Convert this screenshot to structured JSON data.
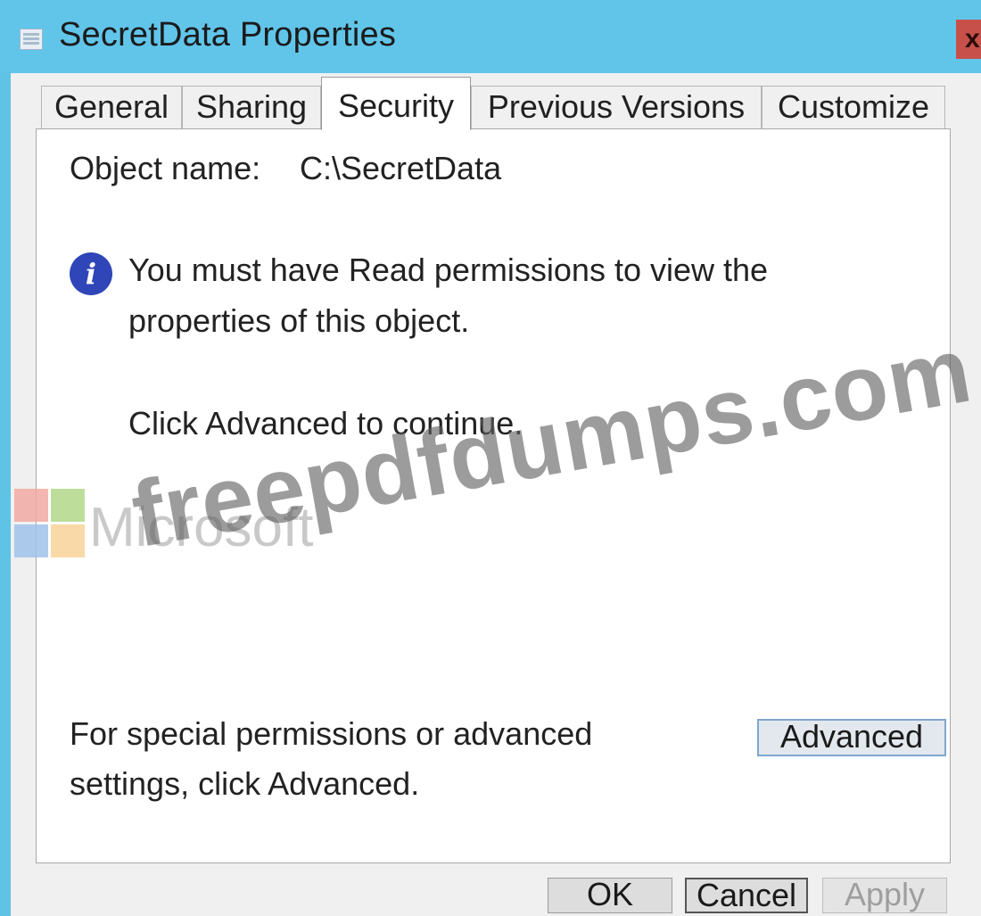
{
  "window": {
    "title": "SecretData Properties",
    "close_label": "x"
  },
  "tabs": [
    {
      "label": "General",
      "active": false
    },
    {
      "label": "Sharing",
      "active": false
    },
    {
      "label": "Security",
      "active": true
    },
    {
      "label": "Previous Versions",
      "active": false
    },
    {
      "label": "Customize",
      "active": false
    }
  ],
  "security": {
    "object_name_label": "Object name:",
    "object_name_value": "C:\\SecretData",
    "info_icon_glyph": "i",
    "info_line_1": "You must have Read permissions to view the",
    "info_line_2": "properties of this object.",
    "continue_text": "Click Advanced to continue.",
    "special_line_1": "For special permissions or advanced",
    "special_line_2": "settings, click Advanced.",
    "advanced_button": "Advanced"
  },
  "footer": {
    "ok_button": "OK",
    "cancel_button": "Cancel",
    "apply_button": "Apply"
  },
  "watermark": {
    "logo_word": "Microsoft",
    "site": "freepdfdumps.com"
  },
  "colors": {
    "title_bar": "#61c5ea",
    "close_button": "#c7504a",
    "info_icon": "#2f45b8",
    "advanced_button_border": "#7ea7cf"
  }
}
